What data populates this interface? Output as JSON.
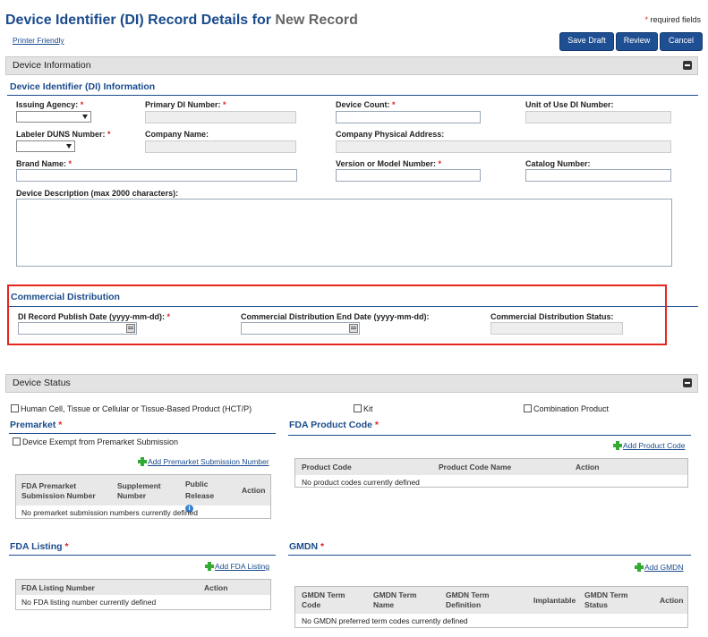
{
  "header": {
    "title": "Device Identifier (DI) Record Details for",
    "title_suffix": "New Record",
    "required_note": "required fields",
    "printer_friendly": "Printer Friendly",
    "buttons": {
      "save_draft": "Save Draft",
      "review": "Review",
      "cancel": "Cancel"
    }
  },
  "device_info": {
    "panel_title": "Device Information",
    "di_section": "Device Identifier (DI) Information",
    "issuing_agency": "Issuing Agency:",
    "primary_di": "Primary DI Number:",
    "device_count": "Device Count:",
    "unit_of_use": "Unit of Use DI Number:",
    "labeler_duns": "Labeler DUNS Number:",
    "company_name": "Company Name:",
    "company_address": "Company Physical Address:",
    "brand_name": "Brand Name:",
    "version_model": "Version or Model Number:",
    "catalog_number": "Catalog Number:",
    "description": "Device Description (max 2000 characters):",
    "asterisk": "*"
  },
  "commercial": {
    "section": "Commercial Distribution",
    "publish_date": "DI Record Publish Date (yyyy-mm-dd):",
    "end_date": "Commercial Distribution End Date (yyyy-mm-dd):",
    "status": "Commercial Distribution Status:"
  },
  "device_status": {
    "panel_title": "Device Status",
    "hctp": "Human Cell, Tissue or Cellular or Tissue-Based Product (HCT/P)",
    "kit": "Kit",
    "combination": "Combination Product"
  },
  "premarket": {
    "section": "Premarket",
    "exempt": "Device Exempt from Premarket Submission",
    "add_link": "Add Premarket Submission Number",
    "columns": [
      "FDA Premarket Submission Number",
      "Supplement Number",
      "Public Release",
      "Action"
    ],
    "empty": "No premarket submission numbers currently defined"
  },
  "product_code": {
    "section": "FDA Product Code",
    "add_link": "Add Product Code",
    "columns": [
      "Product Code",
      "Product Code Name",
      "Action"
    ],
    "empty": "No product codes currently defined"
  },
  "fda_listing": {
    "section": "FDA Listing",
    "add_link": "Add FDA Listing",
    "columns": [
      "FDA Listing Number",
      "Action"
    ],
    "empty": "No FDA listing number currently defined"
  },
  "gmdn": {
    "section": "GMDN",
    "add_link": "Add GMDN",
    "columns": [
      "GMDN Term Code",
      "GMDN Term Name",
      "GMDN Term Definition",
      "Implantable",
      "GMDN Term Status",
      "Action"
    ],
    "empty": "No GMDN preferred term codes currently defined"
  }
}
